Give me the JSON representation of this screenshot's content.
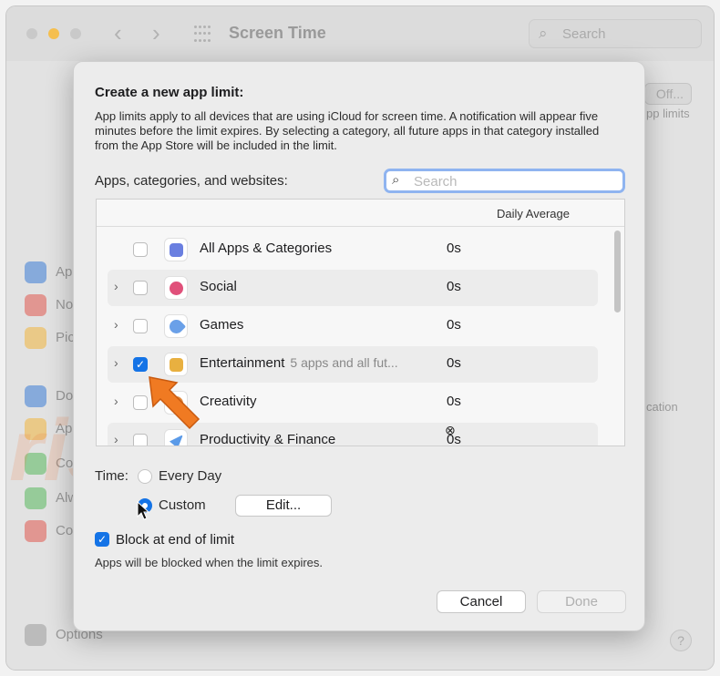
{
  "window": {
    "title": "Screen Time",
    "search_placeholder": "Search",
    "right_off_button": "Off...",
    "right_partial_1": "pp limits",
    "right_partial_2": "cation",
    "options_label": "Options",
    "help_label": "?"
  },
  "sidebar": {
    "items": [
      {
        "label": "Ap",
        "color": "#3a7bd5"
      },
      {
        "label": "No",
        "color": "#e0574f"
      },
      {
        "label": "Pic",
        "color": "#f0b43c"
      },
      {
        "label": "Do",
        "color": "#3a7bd5"
      },
      {
        "label": "Ap",
        "color": "#f0b43c"
      },
      {
        "label": "Co",
        "color": "#58b85c"
      },
      {
        "label": "Alw",
        "color": "#58b85c"
      },
      {
        "label": "Co",
        "color": "#e0574f"
      }
    ]
  },
  "dialog": {
    "title": "Create a new app limit:",
    "description": "App limits apply to all devices that are using iCloud for screen time. A notification will appear five minutes before the limit expires. By selecting a category, all future apps in that category installed from the App Store will be included in the limit.",
    "list_label": "Apps, categories, and websites:",
    "search_placeholder": "Search",
    "column_header": "Daily Average",
    "rows": [
      {
        "label": "All Apps & Categories",
        "sub": "",
        "avg": "0s",
        "expandable": false,
        "checked": false,
        "icon": "stack-icon",
        "icon_color": "#6a7fe0"
      },
      {
        "label": "Social",
        "sub": "",
        "avg": "0s",
        "expandable": true,
        "checked": false,
        "icon": "chat-bubble-icon",
        "icon_color": "#e0507a"
      },
      {
        "label": "Games",
        "sub": "",
        "avg": "0s",
        "expandable": true,
        "checked": false,
        "icon": "rocket-icon",
        "icon_color": "#6aa0e8"
      },
      {
        "label": "Entertainment",
        "sub": "5 apps and all fut...",
        "avg": "0s",
        "expandable": true,
        "checked": true,
        "icon": "popcorn-icon",
        "icon_color": "#e8b040"
      },
      {
        "label": "Creativity",
        "sub": "",
        "avg": "0s",
        "expandable": true,
        "checked": false,
        "icon": "palette-icon",
        "icon_color": "#e08a40"
      },
      {
        "label": "Productivity & Finance",
        "sub": "",
        "avg": "0s",
        "expandable": true,
        "checked": false,
        "icon": "paper-plane-icon",
        "icon_color": "#5a9ae8"
      }
    ],
    "time_label": "Time:",
    "every_day_label": "Every Day",
    "custom_label": "Custom",
    "custom_selected": true,
    "edit_button": "Edit...",
    "block_label": "Block at end of limit",
    "block_checked": true,
    "block_note": "Apps will be blocked when the limit expires.",
    "cancel_button": "Cancel",
    "done_button": "Done"
  },
  "watermark": {
    "line1": "PC",
    "line2": "risk.com"
  },
  "colors": {
    "accent": "#1473e6",
    "annotation_arrow": "#f07a22"
  }
}
